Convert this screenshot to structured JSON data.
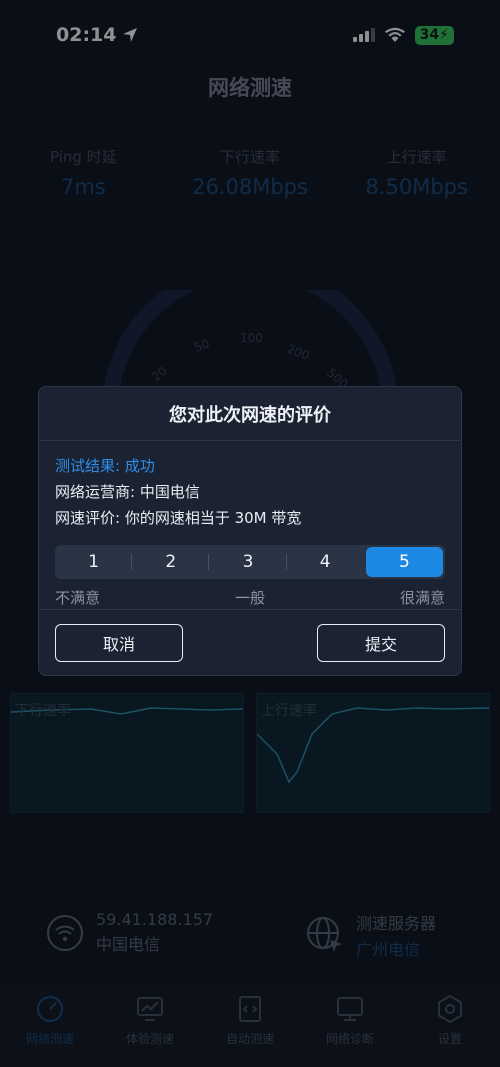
{
  "status_bar": {
    "time": "02:14",
    "battery": "34"
  },
  "page": {
    "title": "网络测速"
  },
  "stats": [
    {
      "label": "Ping 时延",
      "value": "7ms"
    },
    {
      "label": "下行速率",
      "value": "26.08Mbps"
    },
    {
      "label": "上行速率",
      "value": "8.50Mbps"
    }
  ],
  "gauge": {
    "ticks": [
      "20",
      "50",
      "100",
      "200",
      "500"
    ]
  },
  "charts": {
    "down_title": "下行速率",
    "up_title": "上行速率"
  },
  "info": {
    "ip": "59.41.188.157",
    "isp": "中国电信",
    "server_label": "测速服务器",
    "server_value": "广州电信"
  },
  "tabs": [
    {
      "label": "网络测速",
      "icon": "speedometer-icon",
      "active": true
    },
    {
      "label": "体验测速",
      "icon": "chart-monitor-icon",
      "active": false
    },
    {
      "label": "自动测速",
      "icon": "code-file-icon",
      "active": false
    },
    {
      "label": "网络诊断",
      "icon": "monitor-icon",
      "active": false
    },
    {
      "label": "设置",
      "icon": "hexagon-gear-icon",
      "active": false
    }
  ],
  "dialog": {
    "title": "您对此次网速的评价",
    "result": "测试结果: 成功",
    "operator": "网络运营商: 中国电信",
    "evaluation": "网速评价: 你的网速相当于 30M 带宽",
    "ratings": [
      "1",
      "2",
      "3",
      "4",
      "5"
    ],
    "selected_rating": "5",
    "scale_low": "不满意",
    "scale_mid": "一般",
    "scale_high": "很满意",
    "cancel_label": "取消",
    "submit_label": "提交"
  }
}
